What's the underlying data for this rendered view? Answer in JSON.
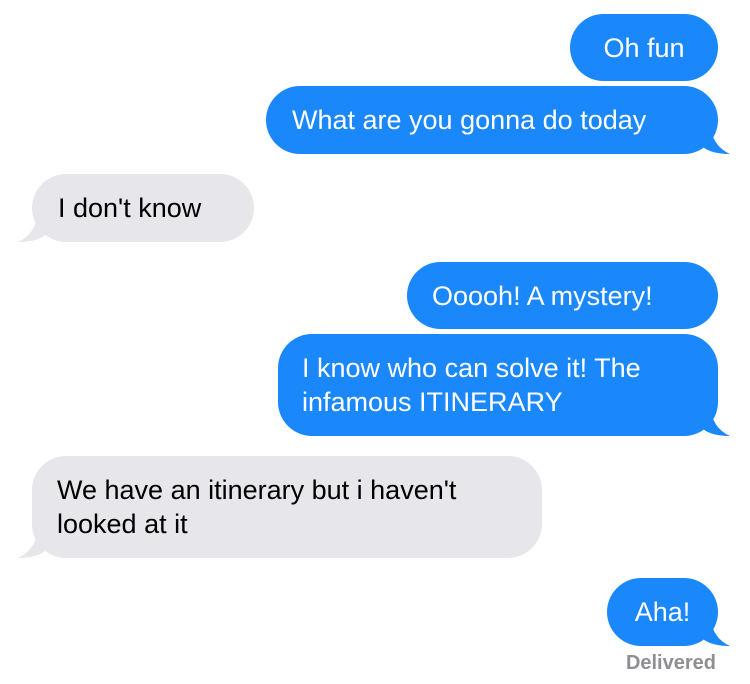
{
  "colors": {
    "outgoing_bubble": "#1a87fb",
    "incoming_bubble": "#e6e6eb",
    "status_text": "#8e8e93"
  },
  "messages": [
    {
      "direction": "outgoing",
      "text": "Oh fun"
    },
    {
      "direction": "outgoing",
      "text": "What are you gonna do today"
    },
    {
      "direction": "incoming",
      "text": "I don't know"
    },
    {
      "direction": "outgoing",
      "text": "Ooooh! A mystery!"
    },
    {
      "direction": "outgoing",
      "text": "I know who can solve it! The infamous ITINERARY"
    },
    {
      "direction": "incoming",
      "text": "We have an itinerary but i haven't looked at it"
    },
    {
      "direction": "outgoing",
      "text": "Aha!"
    }
  ],
  "status": {
    "label": "Delivered"
  }
}
